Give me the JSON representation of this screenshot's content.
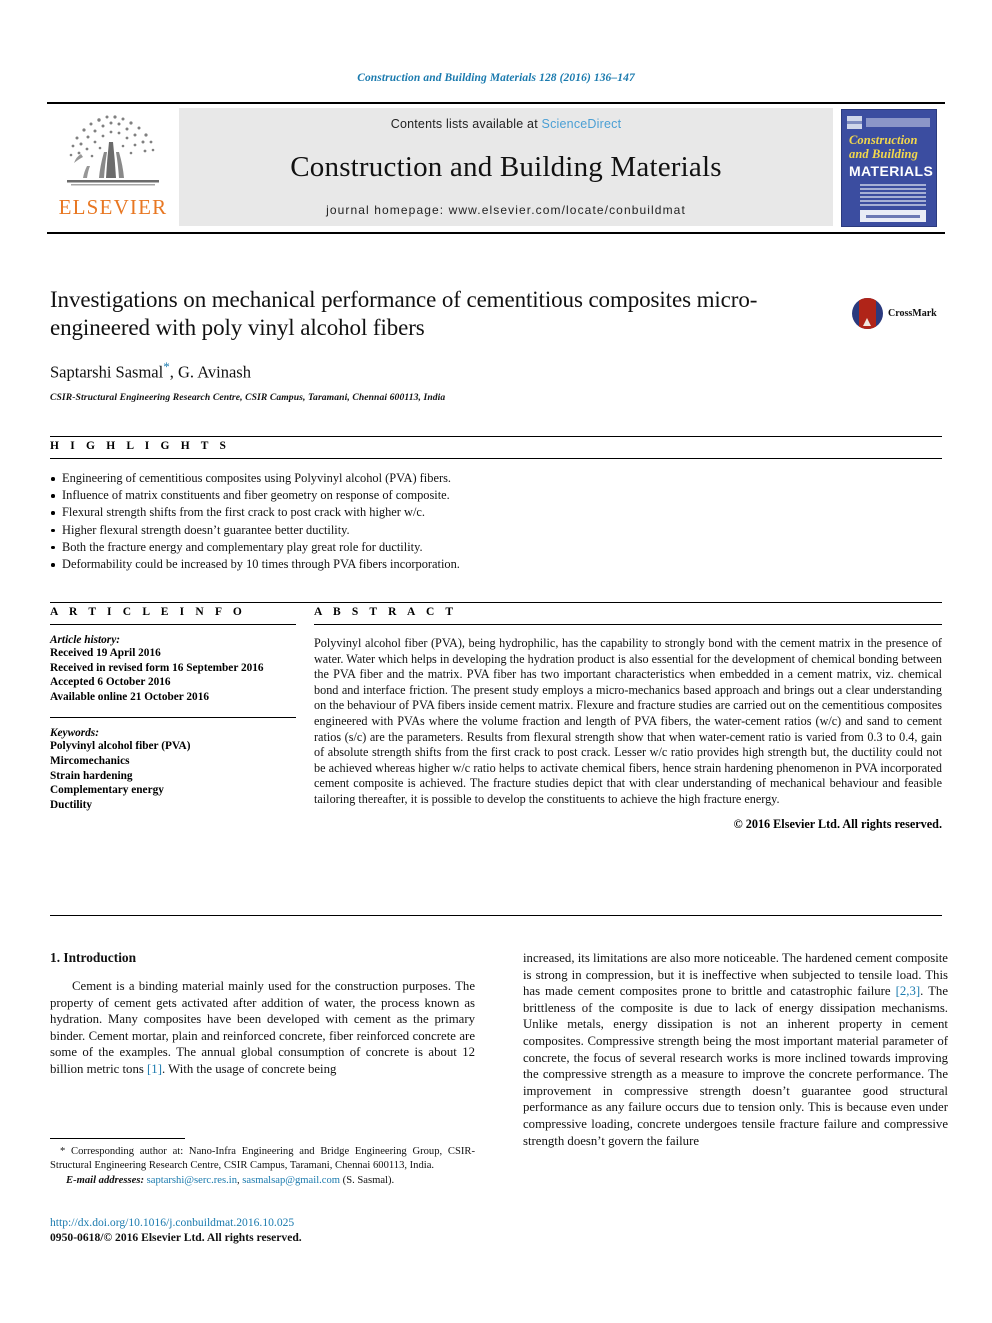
{
  "running_head": "Construction and Building Materials 128 (2016) 136–147",
  "masthead": {
    "contents_prefix": "Contents lists available at ",
    "sciencedirect": "ScienceDirect",
    "journal_name": "Construction and Building Materials",
    "homepage": "journal homepage: www.elsevier.com/locate/conbuildmat",
    "publisher_logo_text": "ELSEVIER",
    "cover": {
      "line1": "Construction",
      "line2": "and Building",
      "line3": "MATERIALS"
    }
  },
  "article": {
    "title": "Investigations on mechanical performance of cementitious composites micro-engineered with poly vinyl alcohol fibers",
    "authors": "Saptarshi Sasmal",
    "authors_marker": "*",
    "authors_rest": ", G. Avinash",
    "affiliation": "CSIR-Structural Engineering Research Centre, CSIR Campus, Taramani, Chennai 600113, India",
    "crossmark_label": "CrossMark"
  },
  "highlights": {
    "label": "H I G H L I G H T S",
    "items": [
      "Engineering of cementitious composites using Polyvinyl alcohol (PVA) fibers.",
      "Influence of matrix constituents and fiber geometry on response of composite.",
      "Flexural strength shifts from the first crack to post crack with higher w/c.",
      "Higher flexural strength doesn’t guarantee better ductility.",
      "Both the fracture energy and complementary play great role for ductility.",
      "Deformability could be increased by 10 times through PVA fibers incorporation."
    ]
  },
  "article_info": {
    "label": "A R T I C L E    I N F O",
    "history_label": "Article history:",
    "history": [
      "Received 19 April 2016",
      "Received in revised form 16 September 2016",
      "Accepted 6 October 2016",
      "Available online 21 October 2016"
    ],
    "keywords_label": "Keywords:",
    "keywords": [
      "Polyvinyl alcohol fiber (PVA)",
      "Mircomechanics",
      "Strain hardening",
      "Complementary energy",
      "Ductility"
    ]
  },
  "abstract": {
    "label": "A B S T R A C T",
    "text": "Polyvinyl alcohol fiber (PVA), being hydrophilic, has the capability to strongly bond with the cement matrix in the presence of water. Water which helps in developing the hydration product is also essential for the development of chemical bonding between the PVA fiber and the matrix. PVA fiber has two important characteristics when embedded in a cement matrix, viz. chemical bond and interface friction. The present study employs a micro-mechanics based approach and brings out a clear understanding on the behaviour of PVA fibers inside cement matrix. Flexure and fracture studies are carried out on the cementitious composites engineered with PVAs where the volume fraction and length of PVA fibers, the water-cement ratios (w/c) and sand to cement ratios (s/c) are the parameters. Results from flexural strength show that when water-cement ratio is varied from 0.3 to 0.4, gain of absolute strength shifts from the first crack to post crack. Lesser w/c ratio provides high strength but, the ductility could not be achieved whereas higher w/c ratio helps to activate chemical fibers, hence strain hardening phenomenon in PVA incorporated cement composite is achieved. The fracture studies depict that with clear understanding of mechanical behaviour and feasible tailoring thereafter, it is possible to develop the constituents to achieve the high fracture energy.",
    "copyright": "© 2016 Elsevier Ltd. All rights reserved."
  },
  "body": {
    "section_title": "1. Introduction",
    "left_paragraph_a": "Cement is a binding material mainly used for the construction purposes. The property of cement gets activated after addition of water, the process known as hydration. Many composites have been developed with cement as the primary binder. Cement mortar, plain and reinforced concrete, fiber reinforced concrete are some of the examples. The annual global consumption of concrete is about 12 billion metric tons ",
    "left_ref_a": "[1]",
    "left_paragraph_b": ". With the usage of concrete being",
    "right_paragraph_a": "increased, its limitations are also more noticeable. The hardened cement composite is strong in compression, but it is ineffective when subjected to tensile load. This has made cement composites prone to brittle and catastrophic failure ",
    "right_ref_a": "[2,3]",
    "right_paragraph_b": ". The brittleness of the composite is due to lack of energy dissipation mechanisms. Unlike metals, energy dissipation is not an inherent property in cement composites. Compressive strength being the most important material parameter of concrete, the focus of several research works is more inclined towards improving the compressive strength as a measure to improve the concrete performance. The improvement in compressive strength doesn’t guarantee good structural performance as any failure occurs due to tension only. This is because even under compressive loading, concrete undergoes tensile fracture failure and compressive strength doesn’t govern the failure"
  },
  "footnote": {
    "corresponding": "* Corresponding author at: Nano-Infra Engineering and Bridge Engineering Group, CSIR-Structural Engineering Research Centre, CSIR Campus, Taramani, Chennai 600113, India.",
    "email_label": "E-mail addresses:",
    "email1": "saptarshi@serc.res.in",
    "email_sep": ", ",
    "email2": "sasmalsap@gmail.com",
    "email_suffix": " (S. Sasmal)."
  },
  "footer": {
    "doi": "http://dx.doi.org/10.1016/j.conbuildmat.2016.10.025",
    "issn": "0950-0618/© 2016 Elsevier Ltd. All rights reserved."
  },
  "colors": {
    "link": "#1a7aae",
    "sciencedirect": "#4a9fd4",
    "elsevier_orange": "#e87722",
    "cover_blue": "#3b4da0"
  }
}
